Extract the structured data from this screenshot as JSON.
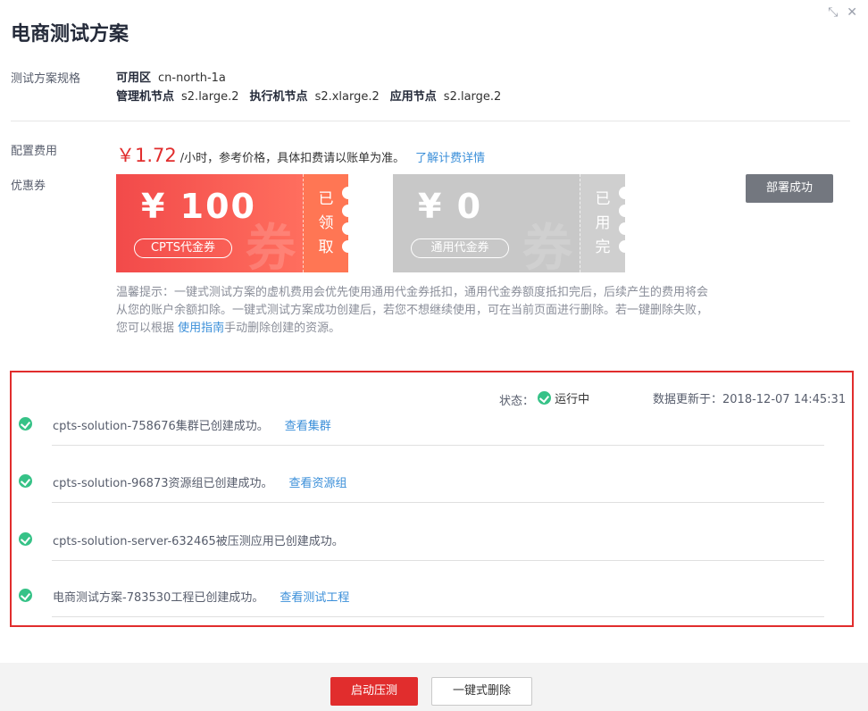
{
  "dialog": {
    "title": "电商测试方案",
    "shrink_icon": "⤡",
    "close_icon": "✕"
  },
  "spec": {
    "label": "测试方案规格",
    "az_label": "可用区",
    "az_value": "cn-north-1a",
    "mgr_label": "管理机节点",
    "mgr_value": "s2.large.2",
    "exec_label": "执行机节点",
    "exec_value": "s2.xlarge.2",
    "app_label": "应用节点",
    "app_value": "s2.large.2"
  },
  "cost": {
    "label": "配置费用",
    "price": "￥1.72",
    "unit_note": "/小时，参考价格，具体扣费请以账单为准。",
    "detail_link": "了解计费详情"
  },
  "coupons": {
    "label": "优惠券",
    "items": [
      {
        "amount": "¥ 100",
        "tag": "CPTS代金券",
        "status": "已领取",
        "watermark": "券"
      },
      {
        "amount": "¥ 0",
        "tag": "通用代金券",
        "status": "已用完",
        "watermark": "券"
      }
    ]
  },
  "deploy_button": "部署成功",
  "tips": {
    "text_1": "温馨提示：一键式测试方案的虚机费用会优先使用通用代金券抵扣，通用代金券额度抵扣完后，后续产生的费用将会从您的账户余额扣除。一键式测试方案成功创建后，若您不想继续使用，可在当前页面进行删除。若一键删除失败，您可以根据 ",
    "link": "使用指南",
    "text_2": "手动删除创建的资源。"
  },
  "status": {
    "label": "状态：",
    "value": "运行中",
    "updated_label": "数据更新于：",
    "updated_time": "2018-12-07 14:45:31"
  },
  "results": [
    {
      "text": "cpts-solution-758676集群已创建成功。",
      "link": "查看集群"
    },
    {
      "text": "cpts-solution-96873资源组已创建成功。",
      "link": "查看资源组"
    },
    {
      "text": "cpts-solution-server-632465被压测应用已创建成功。",
      "link": ""
    },
    {
      "text": "电商测试方案-783530工程已创建成功。",
      "link": "查看测试工程"
    }
  ],
  "footer": {
    "start_button": "启动压测",
    "delete_button": "一键式删除"
  },
  "colors": {
    "accent_red": "#e12d2d",
    "link_blue": "#3b8fd9",
    "success_green": "#36c287"
  }
}
